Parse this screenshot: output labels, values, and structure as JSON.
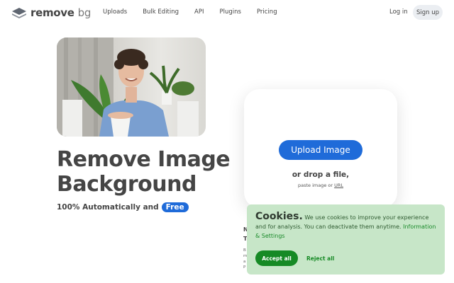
{
  "header": {
    "logo_main": "remove",
    "logo_suffix": "bg",
    "nav": [
      "Uploads",
      "Bulk Editing",
      "API",
      "Plugins",
      "Pricing"
    ],
    "login": "Log in",
    "signup": "Sign up"
  },
  "hero": {
    "headline_line1": "Remove Image",
    "headline_line2": "Background",
    "subline": "100% Automatically and",
    "badge": "Free"
  },
  "upload": {
    "button": "Upload Image",
    "drop_text": "or drop a file,",
    "paste_prefix": "paste image or",
    "paste_url": "URL"
  },
  "cookie": {
    "title": "Cookies.",
    "text": "We use cookies to improve your experience and for analysis. You can deactivate them anytime.",
    "link": "Information & Settings",
    "accept": "Accept all",
    "reject": "Reject all"
  },
  "colors": {
    "primary": "#1f6bd9",
    "cookie_bg": "#c7e6c8",
    "accept": "#168a25",
    "text": "#454545"
  }
}
